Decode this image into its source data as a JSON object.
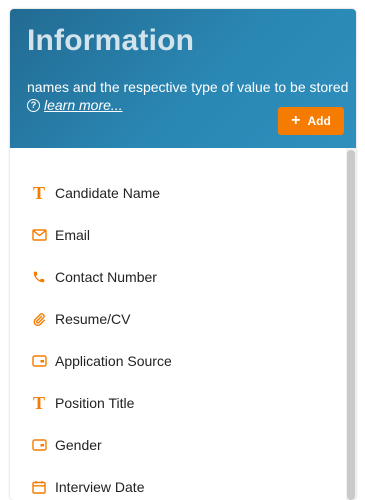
{
  "header": {
    "title": "Information",
    "description": "names and the respective type of value to be stored",
    "learn_more": "learn more...",
    "add_label": "Add"
  },
  "colors": {
    "accent": "#f57c00",
    "header_start": "#226b93",
    "header_end": "#2f8fbd"
  },
  "fields": [
    {
      "label": "Candidate Name",
      "icon": "text-icon"
    },
    {
      "label": "Email",
      "icon": "envelope-icon"
    },
    {
      "label": "Contact Number",
      "icon": "phone-icon"
    },
    {
      "label": "Resume/CV",
      "icon": "paperclip-icon"
    },
    {
      "label": "Application Source",
      "icon": "dropdown-icon"
    },
    {
      "label": "Position Title",
      "icon": "text-icon"
    },
    {
      "label": "Gender",
      "icon": "dropdown-icon"
    },
    {
      "label": "Interview Date",
      "icon": "calendar-icon"
    }
  ]
}
